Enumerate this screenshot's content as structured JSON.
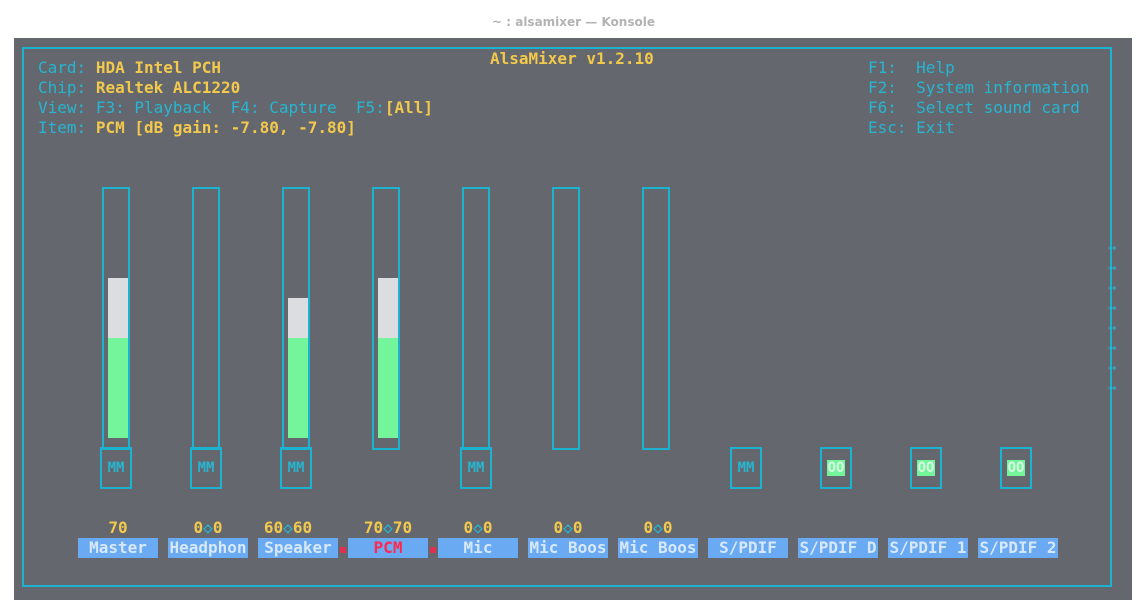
{
  "window": {
    "title": "~ : alsamixer — Konsole"
  },
  "app": {
    "title": "AlsaMixer v1.2.10"
  },
  "info": {
    "card_label": "Card:",
    "card_value": "HDA Intel PCH",
    "chip_label": "Chip:",
    "chip_value": "Realtek ALC1220",
    "view_label": "View:",
    "view_playback": "F3: Playback",
    "view_capture": "F4: Capture",
    "view_f5": "F5:",
    "view_all": "[All]",
    "item_label": "Item:",
    "item_value": "PCM [dB gain: -7.80, -7.80]"
  },
  "help": {
    "f1_key": "F1:",
    "f1_text": "Help",
    "f2_key": "F2:",
    "f2_text": "System information",
    "f6_key": "F6:",
    "f6_text": "Select sound card",
    "esc_key": "Esc:",
    "esc_text": "Exit"
  },
  "scroll_arrow": "→",
  "channels": [
    {
      "name": "Master",
      "value": "70",
      "level": 0.7,
      "mute": "MM"
    },
    {
      "name": "Headphon",
      "value_left": "0",
      "value_right": "0",
      "level": 0,
      "mute": "MM"
    },
    {
      "name": "Speaker",
      "value_left": "60",
      "value_right": "60",
      "level": 0.6,
      "mute": "MM"
    },
    {
      "name": "PCM",
      "value_left": "70",
      "value_right": "70",
      "level": 0.7,
      "selected": true
    },
    {
      "name": "Mic",
      "value_left": "0",
      "value_right": "0",
      "level": 0,
      "mute": "MM"
    },
    {
      "name": "Mic Boos",
      "value_left": "0",
      "value_right": "0",
      "level": 0
    },
    {
      "name": "Mic Boos",
      "value_left": "0",
      "value_right": "0",
      "level": 0
    },
    {
      "name": "S/PDIF",
      "mute": "MM"
    },
    {
      "name": "S/PDIF D",
      "mute": "OO"
    },
    {
      "name": "S/PDIF 1",
      "mute": "OO"
    },
    {
      "name": "S/PDIF 2",
      "mute": "OO"
    }
  ],
  "colors": {
    "background": "#64676d",
    "border": "#1bb3cf",
    "accent": "#f2c94c",
    "level": "#74f49b",
    "label_bg": "#6aaaf2",
    "selected_text": "#ff2850"
  }
}
